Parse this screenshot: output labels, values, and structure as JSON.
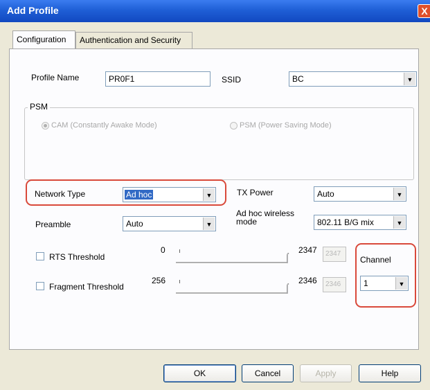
{
  "window": {
    "title": "Add Profile",
    "close_glyph": "X"
  },
  "tabs": [
    {
      "label": "Configuration",
      "active": true
    },
    {
      "label": "Authentication and Security",
      "active": false
    }
  ],
  "profile": {
    "name_label": "Profile Name",
    "name_value": "PR0F1",
    "ssid_label": "SSID",
    "ssid_value": "BC"
  },
  "psm": {
    "legend": "PSM",
    "cam_label": "CAM (Constantly Awake Mode)",
    "psm_label": "PSM (Power Saving Mode)",
    "selected": "cam",
    "disabled": true
  },
  "network_type": {
    "label": "Network Type",
    "value": "Ad hoc"
  },
  "tx_power": {
    "label": "TX Power",
    "value": "Auto"
  },
  "preamble": {
    "label": "Preamble",
    "value": "Auto"
  },
  "adhoc_mode": {
    "label_line1": "Ad hoc wireless",
    "label_line2": "mode",
    "value": "802.11 B/G mix"
  },
  "rts": {
    "label": "RTS Threshold",
    "min": "0",
    "max": "2347",
    "value": "2347",
    "checked": false
  },
  "fragment": {
    "label": "Fragment Threshold",
    "min": "256",
    "max": "2346",
    "value": "2346",
    "checked": false
  },
  "channel": {
    "label": "Channel",
    "value": "1"
  },
  "buttons": {
    "ok": "OK",
    "cancel": "Cancel",
    "apply": "Apply",
    "help": "Help"
  },
  "icons": {
    "dropdown": "chevron-down-icon",
    "close": "close-icon",
    "slider": "slider-thumb-icon"
  },
  "colors": {
    "title_bar": "#1f5fd6",
    "dialog_bg": "#ece9d8",
    "highlight_box": "#d9493a",
    "selection": "#316ac5"
  }
}
